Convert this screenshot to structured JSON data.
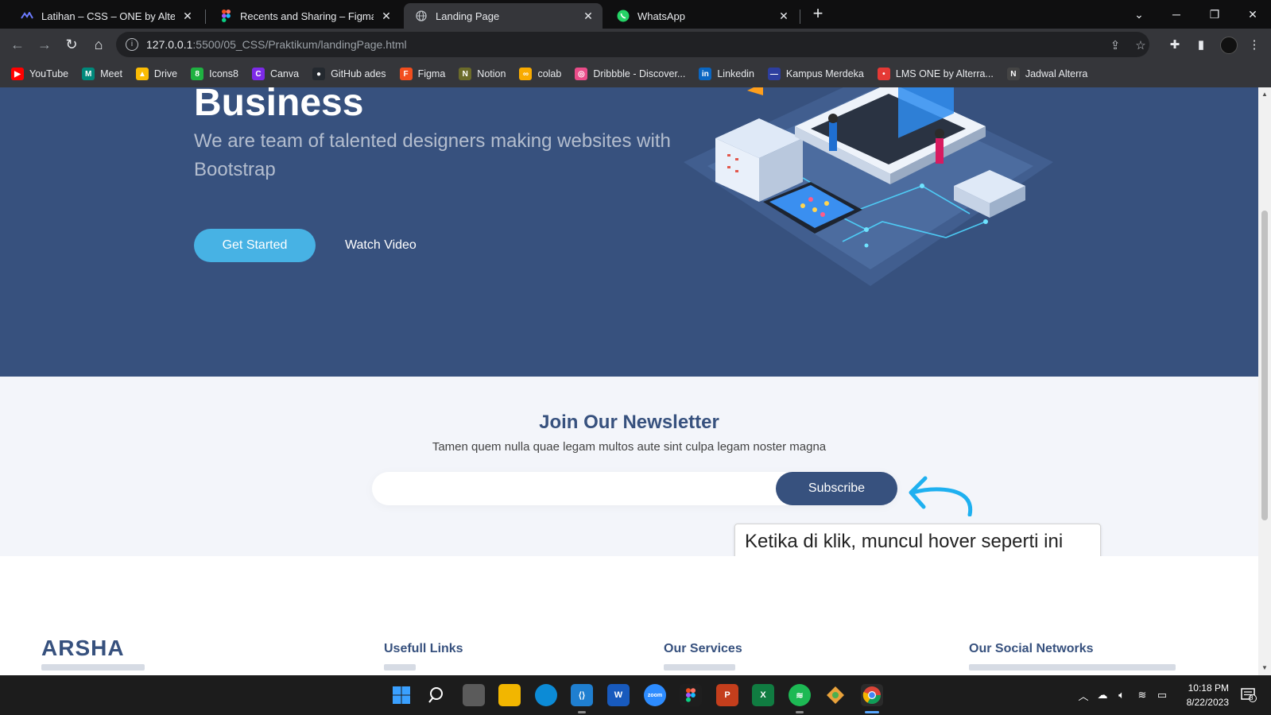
{
  "browser": {
    "tabs": [
      {
        "title": "Latihan – CSS – ONE by Alterra A",
        "icon": "alterra-icon",
        "active": false
      },
      {
        "title": "Recents and Sharing – Figma",
        "icon": "figma-icon",
        "active": false
      },
      {
        "title": "Landing Page",
        "icon": "globe-icon",
        "active": true
      },
      {
        "title": "WhatsApp",
        "icon": "whatsapp-icon",
        "active": false
      }
    ],
    "new_tab": "+",
    "url_host": "127.0.0.1",
    "url_path": ":5500/05_CSS/Praktikum/landingPage.html",
    "bookmarks": [
      {
        "label": "YouTube",
        "color": "#ff0000",
        "glyph": "▶"
      },
      {
        "label": "Meet",
        "color": "#00897b",
        "glyph": "M"
      },
      {
        "label": "Drive",
        "color": "#fbbc04",
        "glyph": "▲"
      },
      {
        "label": "Icons8",
        "color": "#1fb141",
        "glyph": "8"
      },
      {
        "label": "Canva",
        "color": "#7d2ae8",
        "glyph": "C"
      },
      {
        "label": "GitHub ades",
        "color": "#24292f",
        "glyph": "●"
      },
      {
        "label": "Figma",
        "color": "#f24e1e",
        "glyph": "F"
      },
      {
        "label": "Notion",
        "color": "#6b6b2a",
        "glyph": "N"
      },
      {
        "label": "colab",
        "color": "#f9ab00",
        "glyph": "∞"
      },
      {
        "label": "Dribbble - Discover...",
        "color": "#ea4c89",
        "glyph": "◎"
      },
      {
        "label": "Linkedin",
        "color": "#0a66c2",
        "glyph": "in"
      },
      {
        "label": "Kampus Merdeka",
        "color": "#2d3e9f",
        "glyph": "—"
      },
      {
        "label": "LMS ONE by Alterra...",
        "color": "#e53935",
        "glyph": "•"
      },
      {
        "label": "Jadwal Alterra",
        "color": "#444444",
        "glyph": "N"
      }
    ]
  },
  "hero": {
    "title": "Business",
    "subtitle": "We are team of talented designers making websites with Bootstrap",
    "primary_button": "Get Started",
    "secondary_button": "Watch Video"
  },
  "newsletter": {
    "title": "Join Our Newsletter",
    "subtitle": "Tamen quem nulla quae legam multos aute sint culpa legam noster magna",
    "input_value": "",
    "button": "Subscribe",
    "annotation": "Ketika di klik, muncul hover seperti ini"
  },
  "footer": {
    "logo": "ARSHA",
    "col1": "Usefull Links",
    "col2": "Our Services",
    "col3": "Our Social Networks"
  },
  "taskbar": {
    "time": "10:18 PM",
    "date": "8/22/2023",
    "notification_count": "8"
  },
  "colors": {
    "hero_bg": "#37517e",
    "accent": "#47b2e4",
    "newsletter_bg": "#f3f5fa",
    "annotation_arrow": "#1eb0f0"
  }
}
